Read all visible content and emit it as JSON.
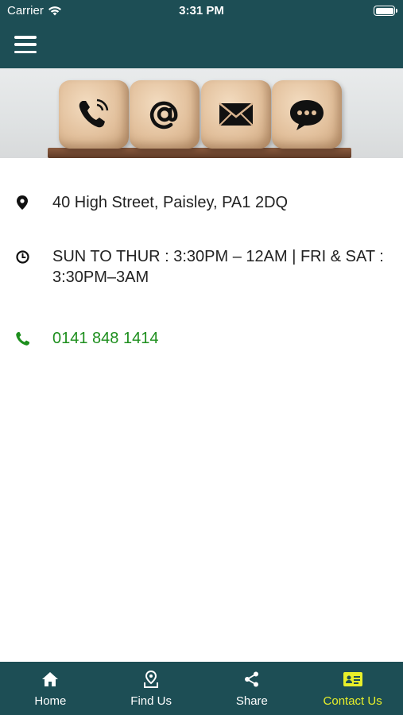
{
  "status_bar": {
    "carrier": "Carrier",
    "time": "3:31 PM"
  },
  "header": {
    "menu_icon": "hamburger-menu-icon"
  },
  "hero": {
    "icons": [
      "phone-icon",
      "at-sign-icon",
      "envelope-icon",
      "chat-bubble-icon"
    ]
  },
  "contact": {
    "address": "40 High Street, Paisley, PA1 2DQ",
    "hours": "SUN TO THUR : 3:30PM – 12AM | FRI & SAT : 3:30PM–3AM",
    "phone": "0141 848 1414",
    "address_icon": "map-pin-icon",
    "hours_icon": "clock-icon",
    "phone_icon": "phone-icon"
  },
  "tabs": [
    {
      "label": "Home",
      "icon": "home-icon"
    },
    {
      "label": "Find Us",
      "icon": "location-pin-icon"
    },
    {
      "label": "Share",
      "icon": "share-icon"
    },
    {
      "label": "Contact Us",
      "icon": "contact-card-icon",
      "active": true
    }
  ],
  "colors": {
    "primary": "#1d4e55",
    "active_tab": "#e8ef2a",
    "phone_link": "#1e8f1e"
  }
}
